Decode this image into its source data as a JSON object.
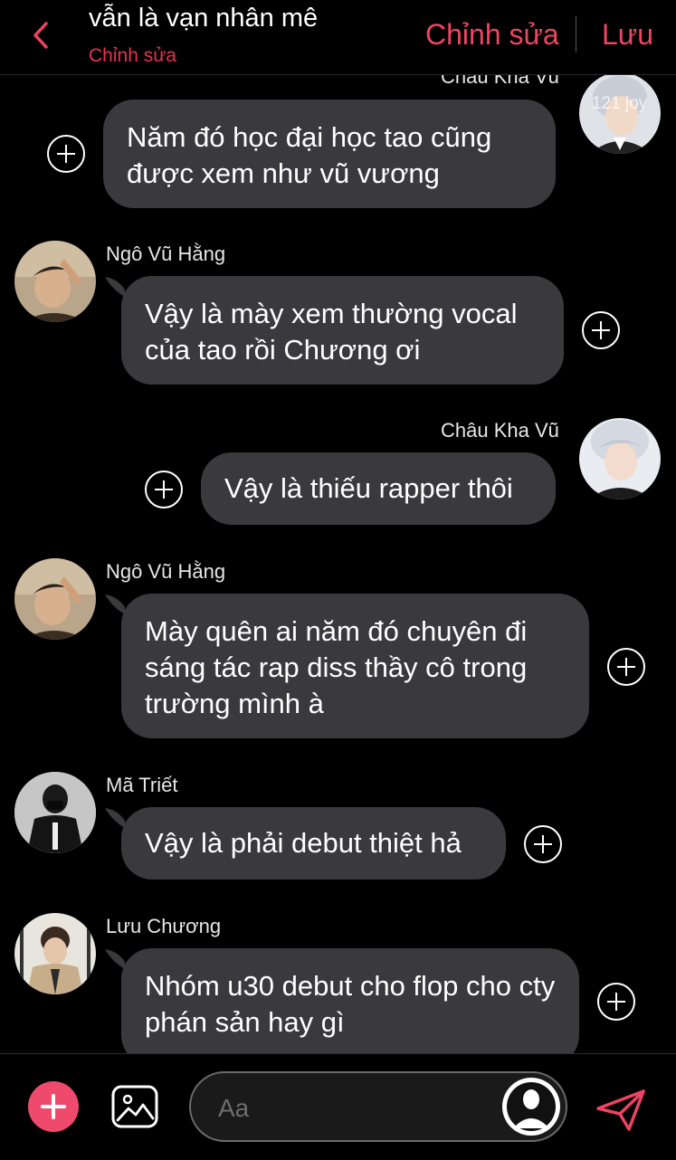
{
  "header": {
    "title": "vẫn là vạn nhân mê",
    "subtitle": "Chỉnh sửa",
    "edit_label": "Chỉnh sửa",
    "save_label": "Lưu"
  },
  "messages": [
    {
      "sender": "Châu Kha Vũ",
      "watermark": "121 joy",
      "text": "Năm đó học đại học tao cũng được xem như vũ vương"
    },
    {
      "sender": "Ngô Vũ Hằng",
      "text": "Vậy là mày xem thường vocal của tao rồi Chương ơi"
    },
    {
      "sender": "Châu Kha Vũ",
      "text": "Vậy là thiếu rapper thôi"
    },
    {
      "sender": "Ngô Vũ Hằng",
      "text": "Mày quên ai năm đó chuyên đi sáng tác rap diss thầy cô trong trường mình à"
    },
    {
      "sender": "Mã Triết",
      "text": "Vậy là phải debut thiệt hả"
    },
    {
      "sender": "Lưu Chương",
      "text": "Nhóm u30 debut cho flop cho cty phán sản hay gì"
    }
  ],
  "composer": {
    "placeholder": "Aa"
  },
  "colors": {
    "accent": "#ee4462",
    "bubble": "#3a3a3c",
    "background": "#000000"
  },
  "icons": [
    "chevron-left-icon",
    "plus-circle-icon",
    "image-icon",
    "send-icon",
    "avatar-placeholder-icon"
  ]
}
